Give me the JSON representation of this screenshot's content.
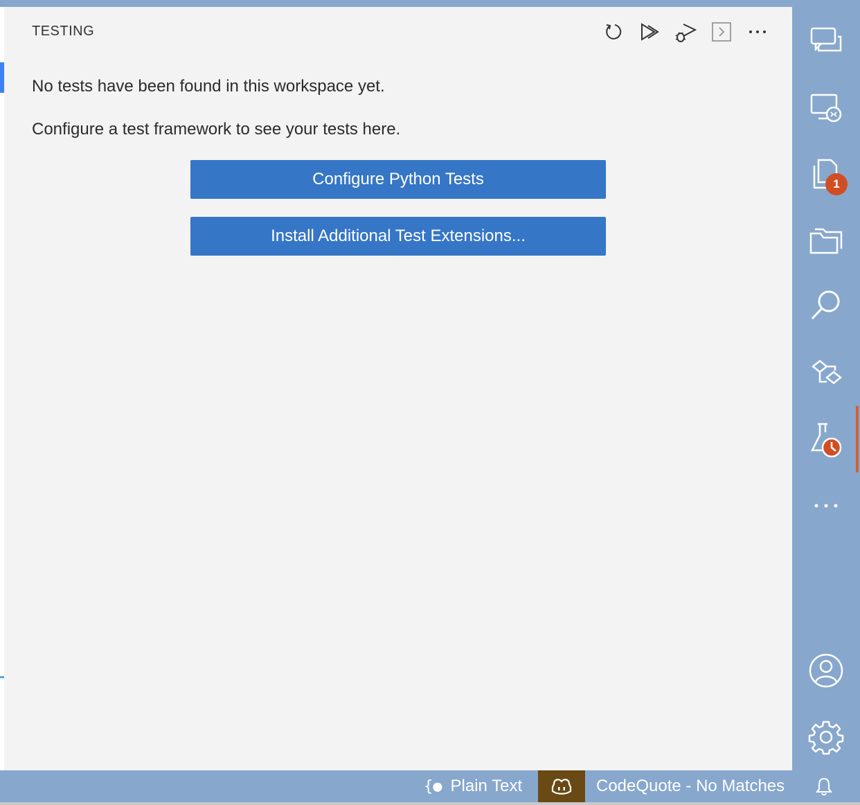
{
  "panel": {
    "title": "TESTING",
    "toolbar": [
      "refresh-icon",
      "run-tests-icon",
      "debug-tests-icon",
      "show-output-icon",
      "more-actions-icon"
    ],
    "message_line1": "No tests have been found in this workspace yet.",
    "message_line2": "Configure a test framework to see your tests here.",
    "buttons": {
      "configure": "Configure Python Tests",
      "install": "Install Additional Test Extensions..."
    }
  },
  "activity_bar": {
    "items": [
      "chat-icon",
      "remote-explorer-icon",
      "explorer-icon",
      "folders-icon",
      "search-icon",
      "source-control-icon",
      "testing-icon",
      "more-icon",
      "accounts-icon",
      "settings-gear-icon"
    ],
    "explorer_badge": "1",
    "active_item": "testing-icon"
  },
  "status_bar": {
    "language_mode": "Plain Text",
    "codequote": "CodeQuote - No Matches"
  },
  "colors": {
    "panel_bg": "#f3f3f3",
    "button_bg": "#3676c6",
    "activity_bg": "#87a7cd",
    "badge": "#d14e24",
    "copilot_bg": "#6a4a14"
  }
}
